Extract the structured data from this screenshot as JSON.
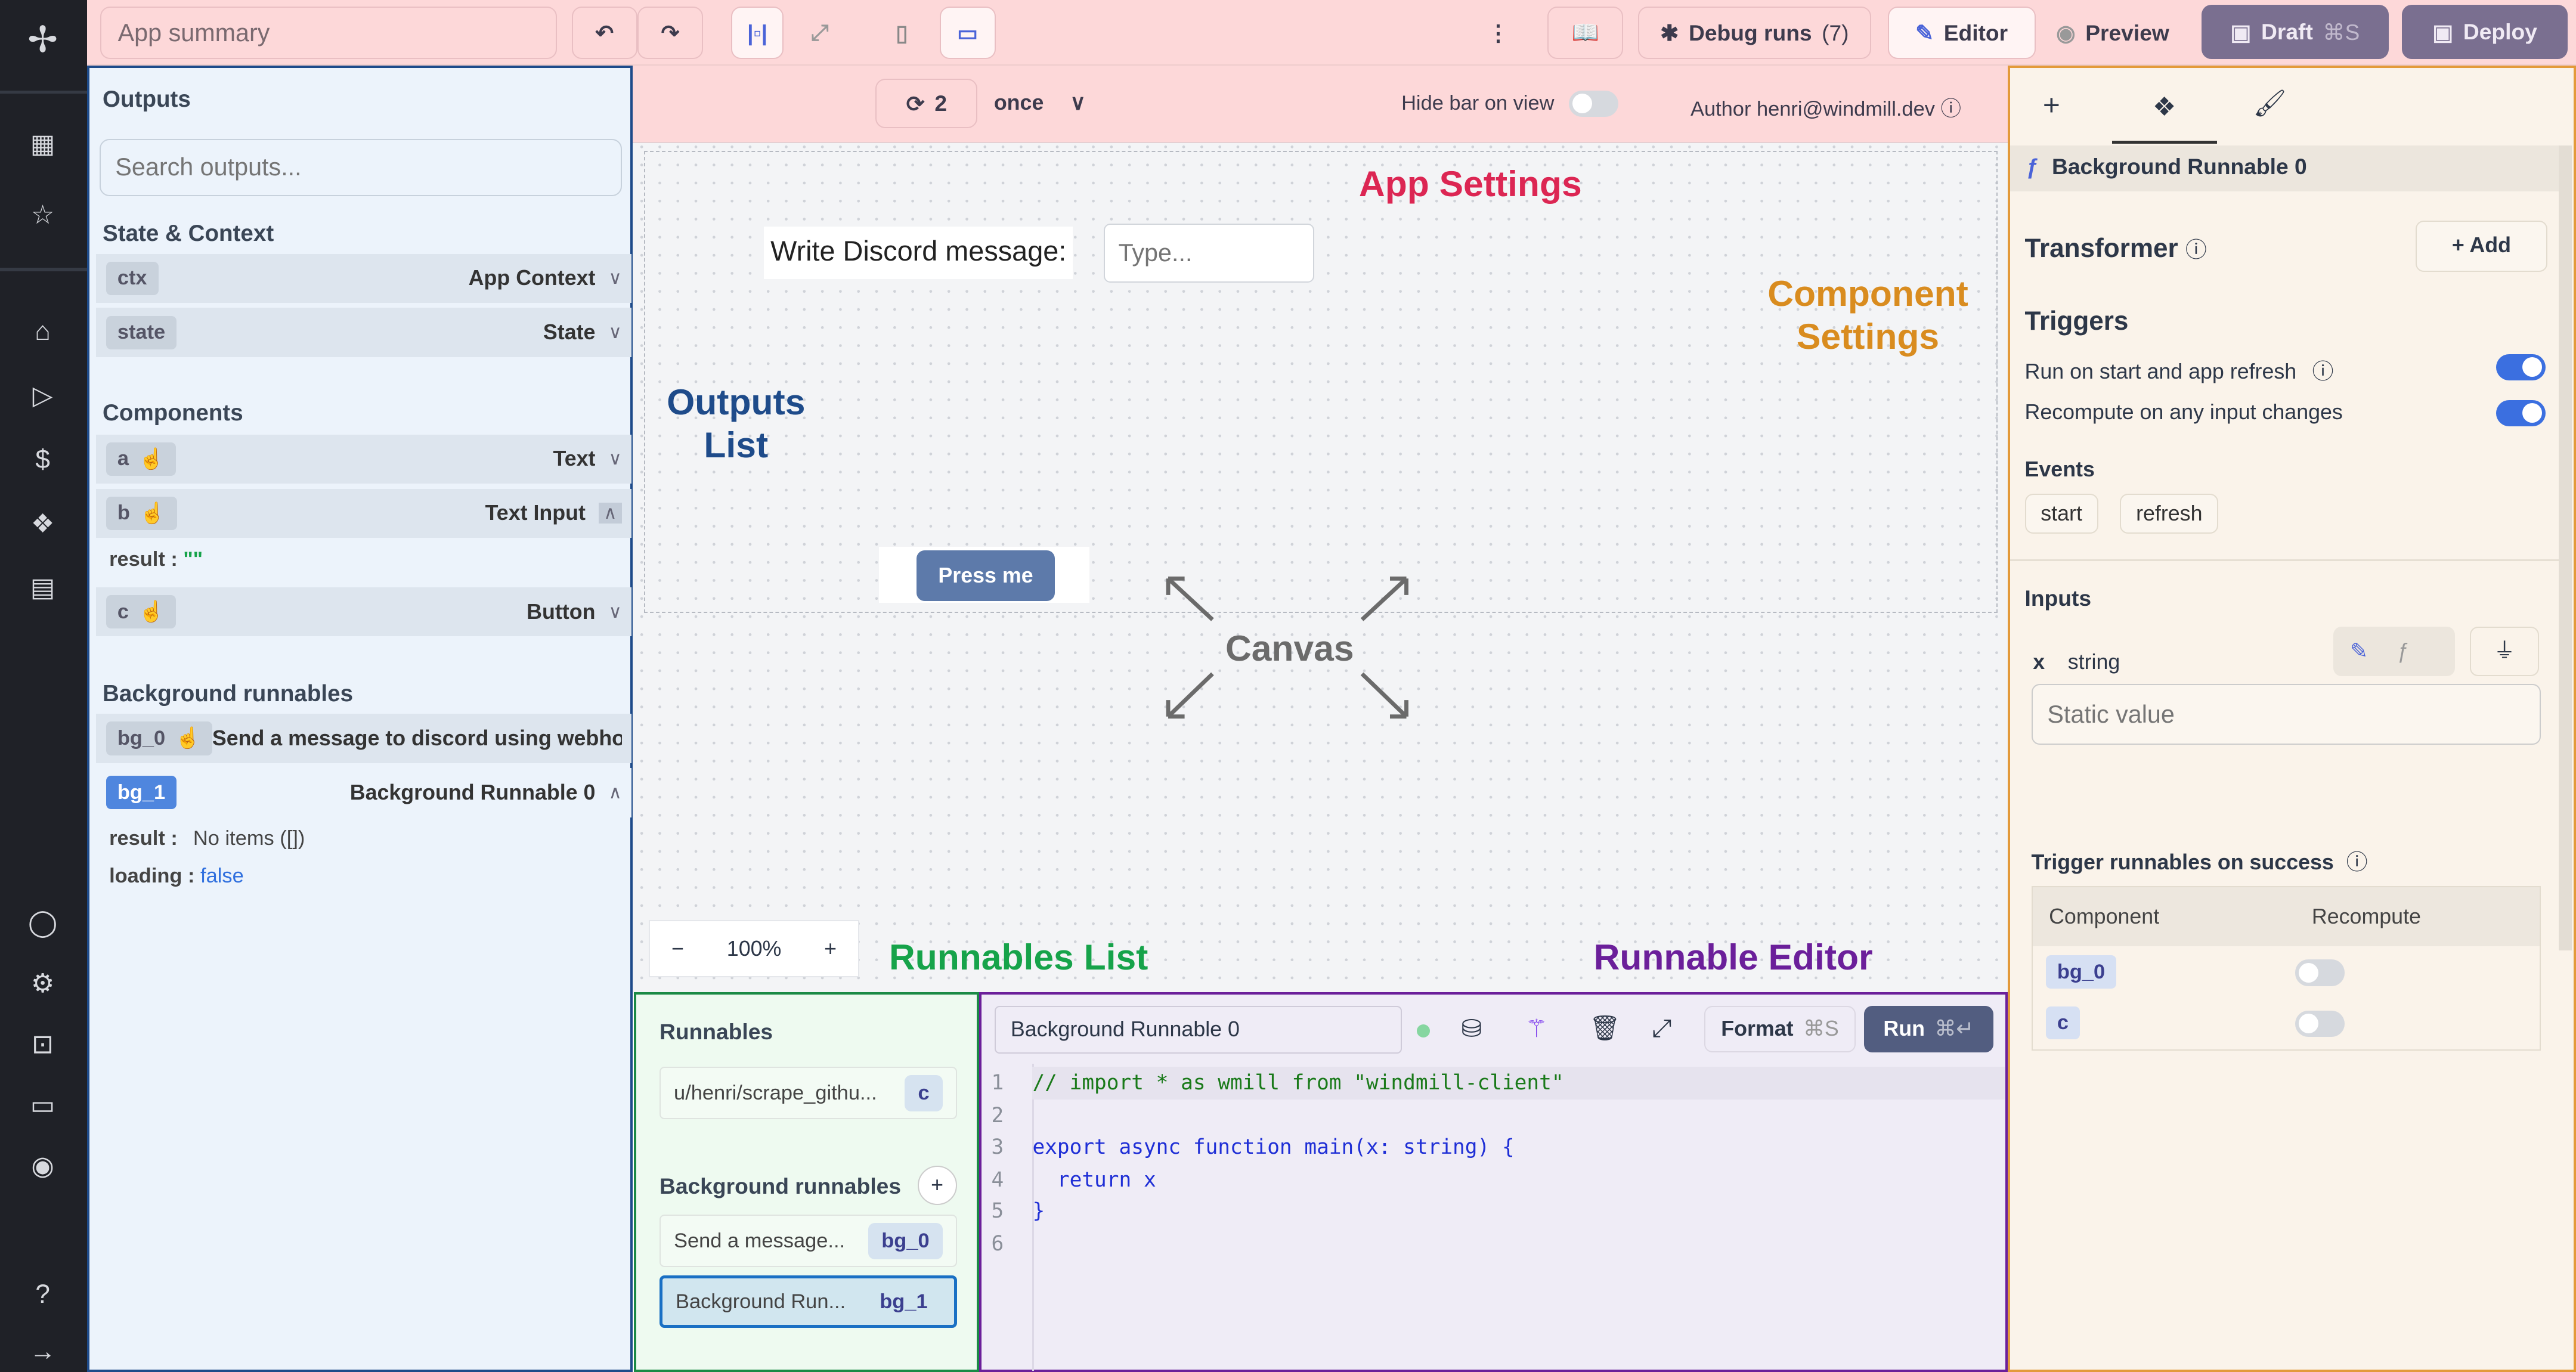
{
  "sidebar": {
    "items": [
      "windmill-logo",
      "apps-icon",
      "star-icon",
      "home-icon",
      "play-icon",
      "dollar-icon",
      "cubes-icon",
      "calendar-icon",
      "user-icon",
      "settings-icon",
      "robot-icon",
      "folder-icon",
      "eye-icon",
      "help-icon",
      "arrow-right-icon"
    ]
  },
  "topbar": {
    "app_title": "App summary",
    "debug_runs": "Debug runs",
    "debug_count": "(7)",
    "editor": "Editor",
    "preview": "Preview",
    "draft": "Draft",
    "draft_shortcut": "⌘S",
    "deploy": "Deploy"
  },
  "outputs": {
    "title": "Outputs",
    "search_placeholder": "Search outputs...",
    "state_title": "State & Context",
    "state": [
      {
        "id": "ctx",
        "label": "App Context"
      },
      {
        "id": "state",
        "label": "State"
      }
    ],
    "components_title": "Components",
    "components": [
      {
        "id": "a",
        "label": "Text"
      },
      {
        "id": "b",
        "label": "Text Input"
      },
      {
        "id": "c",
        "label": "Button"
      }
    ],
    "b_result_key": "result",
    "b_result_val": "\"\"",
    "bg_title": "Background runnables",
    "bg": [
      {
        "id": "bg_0",
        "label": "Send a message to discord using webhoo"
      },
      {
        "id": "bg_1",
        "label": "Background Runnable 0"
      }
    ],
    "bg1_result_key": "result",
    "bg1_result_val": "No items ([])",
    "bg1_loading_key": "loading",
    "bg1_loading_val": "false"
  },
  "canvas": {
    "refresh_count": "2",
    "refresh_mode": "once",
    "hide_bar": "Hide bar on view",
    "author": "Author henri@windmill.dev",
    "text_label": "Write Discord message:",
    "input_placeholder": "Type...",
    "button": "Press me",
    "zoom": "100%"
  },
  "annotations": {
    "app_settings": "App Settings",
    "component_settings": "Component Settings",
    "outputs_list": "Outputs List",
    "canvas": "Canvas",
    "runnables_list": "Runnables List",
    "runnable_editor": "Runnable Editor"
  },
  "colors": {
    "app_settings": "#dc2653",
    "component_settings": "#d98c1f",
    "outputs_list": "#1e4b8a",
    "canvas": "#6b6b6b",
    "runnables_list": "#16a34a",
    "runnable_editor": "#6b1f9a"
  },
  "runnables": {
    "title": "Runnables",
    "items": [
      {
        "name": "u/henri/scrape_githu...",
        "id": "c"
      }
    ],
    "bg_title": "Background runnables",
    "bg_items": [
      {
        "name": "Send a message...",
        "id": "bg_0"
      },
      {
        "name": "Background Run...",
        "id": "bg_1"
      }
    ]
  },
  "editor": {
    "name": "Background Runnable 0",
    "format": "Format",
    "format_shortcut": "⌘S",
    "run": "Run",
    "run_shortcut": "⌘↵",
    "lines": [
      "// import * as wmill from \"windmill-client\"",
      "",
      "export async function main(x: string) {",
      "  return x",
      "}",
      ""
    ]
  },
  "settings": {
    "runnable_title": "Background Runnable 0",
    "transformer": "Transformer",
    "add": "Add",
    "triggers": "Triggers",
    "run_on_start": "Run on start and app refresh",
    "run_on_start_on": true,
    "recompute": "Recompute on any input changes",
    "recompute_on": true,
    "events": "Events",
    "event_items": [
      "start",
      "refresh"
    ],
    "inputs": "Inputs",
    "input_name": "x",
    "input_type": "string",
    "static_placeholder": "Static value",
    "trigger_title": "Trigger runnables on success",
    "col_component": "Component",
    "col_recompute": "Recompute",
    "trigger_rows": [
      {
        "id": "bg_0",
        "recompute": false
      },
      {
        "id": "c",
        "recompute": false
      }
    ]
  }
}
